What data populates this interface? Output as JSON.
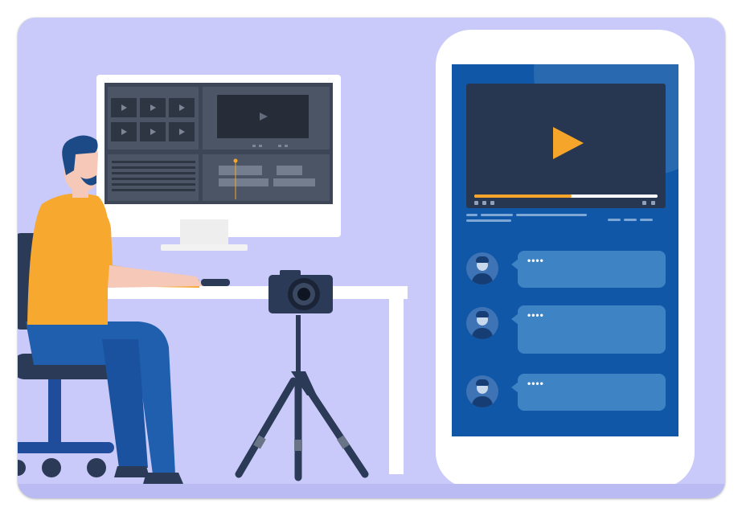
{
  "illustration": {
    "background_color": "#c9caf9",
    "accent_color": "#f5a52a",
    "phone_screen_color": "#1058a7"
  },
  "phone": {
    "video": {
      "icon": "play-icon",
      "progress": 0.53
    },
    "comments": [
      {
        "avatar": "user-avatar-icon",
        "text": "••••"
      },
      {
        "avatar": "user-avatar-icon",
        "text": "••••"
      },
      {
        "avatar": "user-avatar-icon",
        "text": "••••"
      }
    ]
  },
  "desk_scene": {
    "objects": [
      "person-at-desk",
      "monitor-video-editor",
      "office-chair",
      "camera-on-tripod"
    ]
  }
}
